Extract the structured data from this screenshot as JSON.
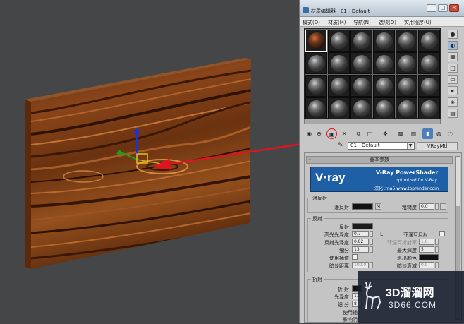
{
  "window": {
    "title": "材质编辑器 - 01 - Default",
    "min_label": "—",
    "restore_label": "□",
    "close_label": "×"
  },
  "menu": [
    "模式(D)",
    "材质(M)",
    "导航(N)",
    "选项(O)",
    "实用程序(U)"
  ],
  "material": {
    "name": "01 - Default",
    "type": "VRayMtl"
  },
  "rollout": {
    "title": "基本参数",
    "collapse_label": "-"
  },
  "banner": {
    "logo": "V·ray",
    "product": "V-Ray PowerShader",
    "optimized": "optimized for V-Ray",
    "credit": "汉化 :ma5 www.toprender.com"
  },
  "diffuse": {
    "group": "漫反射",
    "diffuse_label": "漫反射",
    "map_button": "M",
    "roughness_label": "粗糙度",
    "roughness_value": "0.0"
  },
  "reflection": {
    "group": "反射",
    "reflect_label": "反射",
    "hilight_gloss_label": "高光光泽度",
    "hilight_gloss_value": "0.7",
    "lock_label": "L",
    "fresnel_label": "菲涅耳反射",
    "refl_gloss_label": "反射光泽度",
    "refl_gloss_value": "0.82",
    "fresnel_ior_label": "菲涅耳折射率",
    "fresnel_ior_value": "1.6",
    "subdivs_label": "细分",
    "subdivs_value": "13",
    "max_depth_label": "最大深度",
    "max_depth_value": "5",
    "interp_label": "使用插值",
    "exit_color_label": "退出颜色",
    "dim_dist_label": "暗淡距离",
    "dim_dist_value": "100.0",
    "dim_falloff_label": "暗淡衰减",
    "dim_falloff_value": "0.0"
  },
  "refraction": {
    "group": "折射",
    "refract_label": "折 射",
    "gloss_label": "光泽度",
    "gloss_value": "1.0",
    "subdivs_label": "细 分",
    "subdivs_value": "8",
    "interp_label": "使用插",
    "shadow_label": "影响阴"
  },
  "watermark": {
    "title": "3D溜溜网",
    "url": "3D66.COM"
  },
  "colors": {
    "accent": "#4d7fbc",
    "annotation": "#e0141e",
    "wood": "#7a3a14"
  },
  "icons": [
    "close-icon",
    "pick-material-icon",
    "gizmo-icon",
    "sphere-icon",
    "backlight-icon",
    "checker-icon"
  ]
}
